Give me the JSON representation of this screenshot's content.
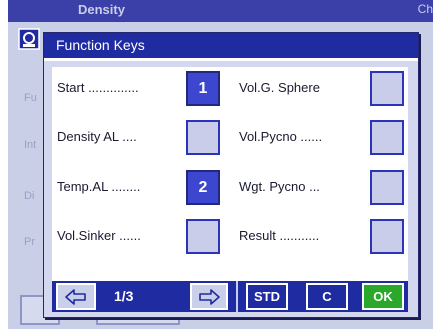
{
  "background": {
    "title": "Density",
    "corner": "Ch",
    "items": [
      "Fu",
      "Int",
      "Di",
      "Pr"
    ]
  },
  "dialog": {
    "title": "Function Keys",
    "left_fields": [
      {
        "label": "Start ..............",
        "key": "1",
        "assigned": true
      },
      {
        "label": "Density  AL ....",
        "key": "",
        "assigned": false
      },
      {
        "label": "Temp.AL ........",
        "key": "2",
        "assigned": true
      },
      {
        "label": "Vol.Sinker ......",
        "key": "",
        "assigned": false
      }
    ],
    "right_fields": [
      {
        "label": "Vol.G. Sphere",
        "key": "",
        "assigned": false
      },
      {
        "label": "Vol.Pycno ......",
        "key": "",
        "assigned": false
      },
      {
        "label": "Wgt. Pycno  ...",
        "key": "",
        "assigned": false
      },
      {
        "label": "Result ...........",
        "key": "",
        "assigned": false
      }
    ],
    "nav": {
      "prev_icon": "arrow-left-icon",
      "page": "1/3",
      "next_icon": "arrow-right-icon",
      "std": "STD",
      "c": "C",
      "ok": "OK"
    }
  },
  "colors": {
    "accent": "#1f2ba0",
    "key_filled": "#3d46ce",
    "key_empty": "#c9cde9",
    "ok": "#2aa82a"
  }
}
